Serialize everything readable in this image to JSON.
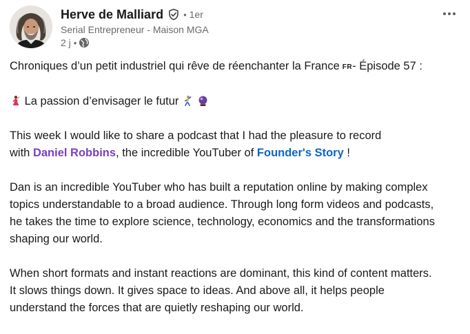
{
  "author": {
    "name": "Herve de Malliard",
    "degree": "1er",
    "separator": "•",
    "headline": "Serial Entrepreneur - Maison MGA",
    "time_ago": "2 j",
    "icons": {
      "verified": "verified-shield-icon",
      "visibility": "globe-icon",
      "avatar": "profile-photo"
    }
  },
  "menu": {
    "more_label": "•••",
    "icon": "more-horizontal-icon"
  },
  "post": {
    "title_line": {
      "text": "Chroniques d’un petit industriel qui rêve de réenchanter la France",
      "flag": "FR",
      "suffix": "- Épisode 57 :"
    },
    "subtitle_line": {
      "text": "La passion d’envisager le futur",
      "icons": [
        "woman-dancing-emoji",
        "person-dancing-emoji",
        "crystal-ball-emoji"
      ]
    },
    "para1": {
      "intro": "This week I would like to share a podcast that I had the pleasure to record",
      "with": "with",
      "mention": "Daniel Robbins",
      "mid": ", the incredible YouTuber of",
      "page": "Founder's Story",
      "end": " !"
    },
    "para2": {
      "line1": "Dan is an incredible YouTuber who has built a reputation online by making complex",
      "line2": "topics understandable to a broad audience. Through long form videos and podcasts,",
      "line3": "he takes the time to explore science, technology, economics and the transformations",
      "line4": "shaping our world."
    },
    "para3": {
      "line1": "When short formats and instant reactions are dominant, this kind of content matters.",
      "line2": "It slows things down. It gives space to ideas. And above all, it helps people",
      "line3": "understand the forces that are quietly reshaping our world."
    }
  },
  "colors": {
    "mention": "#7b3fc2",
    "link": "#0a66c2",
    "text": "#191919",
    "secondary": "#666666"
  }
}
